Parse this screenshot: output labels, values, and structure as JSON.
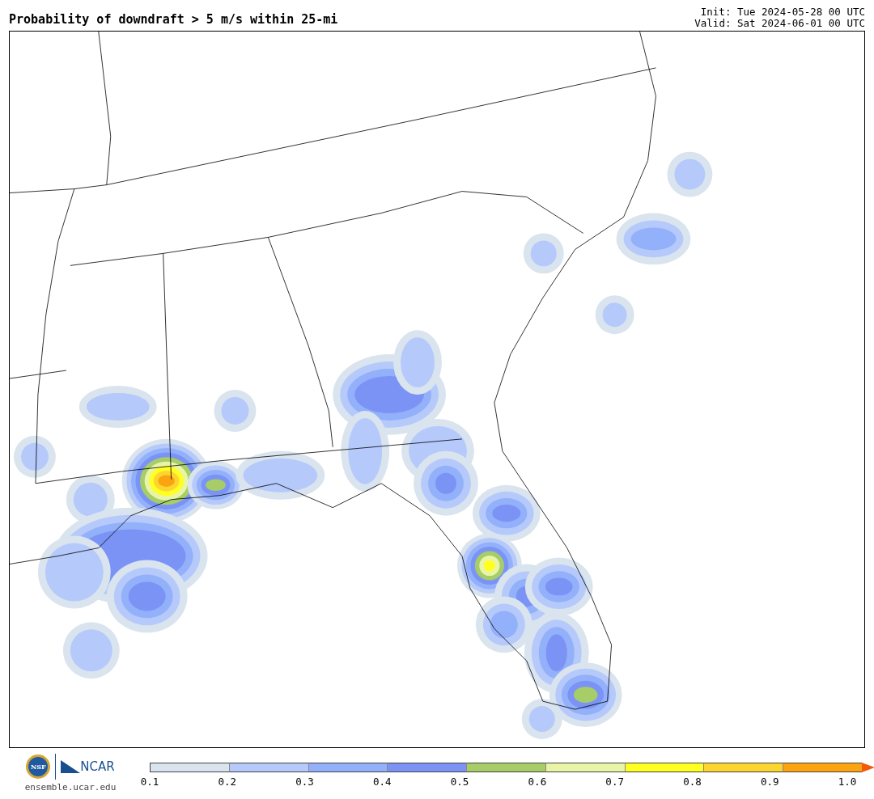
{
  "title": "Probability of downdraft > 5 m/s within 25-mi",
  "init": "Init: Tue 2024-05-28 00 UTC",
  "valid": "Valid: Sat 2024-06-01 00 UTC",
  "logo": {
    "nsf": "NSF",
    "ncar": "NCAR",
    "site": "ensemble.ucar.edu"
  },
  "colorbar": {
    "bins": [
      {
        "color": "#d9e4ef"
      },
      {
        "color": "#b5c9fb"
      },
      {
        "color": "#93b0fa"
      },
      {
        "color": "#7b93f5"
      },
      {
        "color": "#a6cd68"
      },
      {
        "color": "#e9f5a6"
      },
      {
        "color": "#ffff22"
      },
      {
        "color": "#fdd530"
      },
      {
        "color": "#fca40f"
      }
    ],
    "extend_arrow": {
      "color": "#f2590c"
    },
    "ticks": [
      "0.1",
      "0.2",
      "0.3",
      "0.4",
      "0.5",
      "0.6",
      "0.7",
      "0.8",
      "0.9",
      "1.0"
    ]
  }
}
